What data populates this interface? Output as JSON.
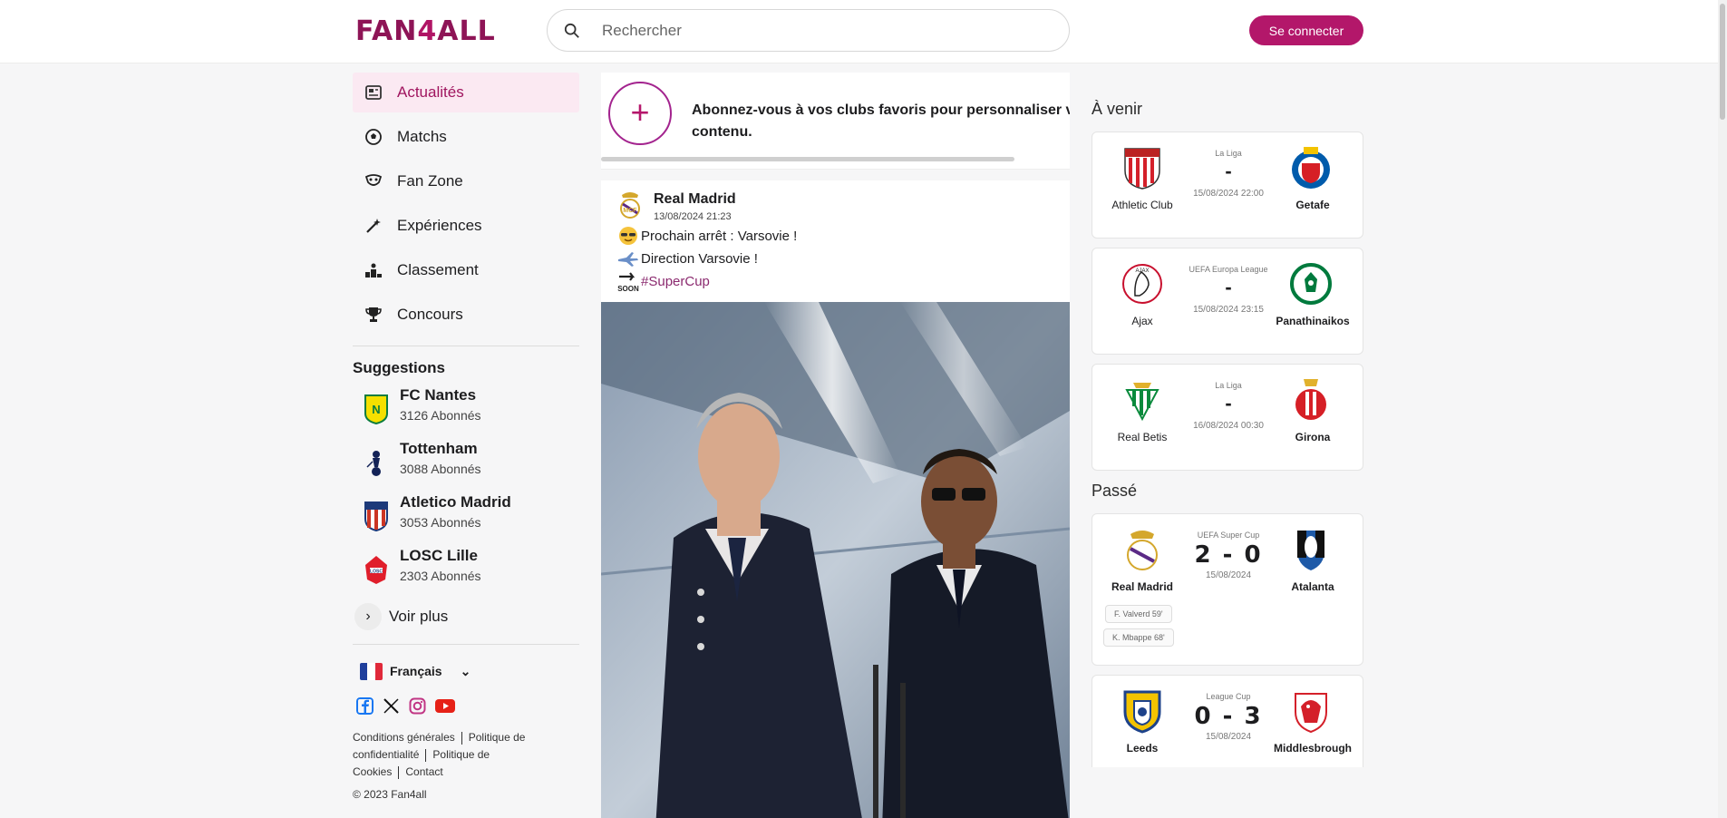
{
  "header": {
    "logo_prefix": "Fan",
    "logo_four": "4",
    "logo_suffix": "all",
    "search_placeholder": "Rechercher",
    "login_label": "Se connecter"
  },
  "nav": {
    "items": [
      {
        "label": "Actualités",
        "icon": "newspaper-icon",
        "active": true
      },
      {
        "label": "Matchs",
        "icon": "soccer-ball-icon"
      },
      {
        "label": "Fan Zone",
        "icon": "fan-zone-icon"
      },
      {
        "label": "Expériences",
        "icon": "magic-wand-icon"
      },
      {
        "label": "Classement",
        "icon": "podium-icon"
      },
      {
        "label": "Concours",
        "icon": "trophy-icon"
      }
    ]
  },
  "suggestions": {
    "title": "Suggestions",
    "items": [
      {
        "name": "FC Nantes",
        "subs": "3126 Abonnés",
        "color": "#f5e000"
      },
      {
        "name": "Tottenham",
        "subs": "3088 Abonnés",
        "color": "#132257"
      },
      {
        "name": "Atletico Madrid",
        "subs": "3053 Abonnés",
        "color": "#cb3524"
      },
      {
        "name": "LOSC Lille",
        "subs": "2303 Abonnés",
        "color": "#e01e2b"
      }
    ],
    "more_label": "Voir plus"
  },
  "footer": {
    "language": "Français",
    "legal": {
      "cg": "Conditions générales",
      "privacy_1": "Politique de",
      "privacy_2": "confidentialité",
      "cookies_1": "Politique de",
      "cookies_2": "Cookies",
      "contact": "Contact"
    },
    "copyright": "© 2023 Fan4all"
  },
  "subscribe": {
    "text": "Abonnez-vous à vos clubs favoris pour personnaliser votre contenu."
  },
  "post": {
    "author": "Real Madrid",
    "date": "13/08/2024 21:23",
    "line1": "Prochain arrêt : Varsovie !",
    "line2": "Direction Varsovie !",
    "hashtag": "#SuperCup",
    "soon_label": "SOON"
  },
  "upcoming": {
    "title": "À venir",
    "matches": [
      {
        "home": "Athletic Club",
        "away": "Getafe",
        "competition": "La Liga",
        "score": "-",
        "date": "15/08/2024 22:00"
      },
      {
        "home": "Ajax",
        "away": "Panathinaikos",
        "competition": "UEFA Europa League",
        "score": "-",
        "date": "15/08/2024 23:15"
      },
      {
        "home": "Real Betis",
        "away": "Girona",
        "competition": "La Liga",
        "score": "-",
        "date": "16/08/2024 00:30"
      }
    ]
  },
  "past": {
    "title": "Passé",
    "matches": [
      {
        "home": "Real Madrid",
        "away": "Atalanta",
        "competition": "UEFA Super Cup",
        "score": "2 - 0",
        "date": "15/08/2024",
        "scorers": [
          "F. Valverd 59'",
          "K. Mbappe 68'"
        ]
      },
      {
        "home": "Leeds",
        "away": "Middlesbrough",
        "competition": "League Cup",
        "score": "0 - 3",
        "date": "15/08/2024"
      }
    ]
  }
}
